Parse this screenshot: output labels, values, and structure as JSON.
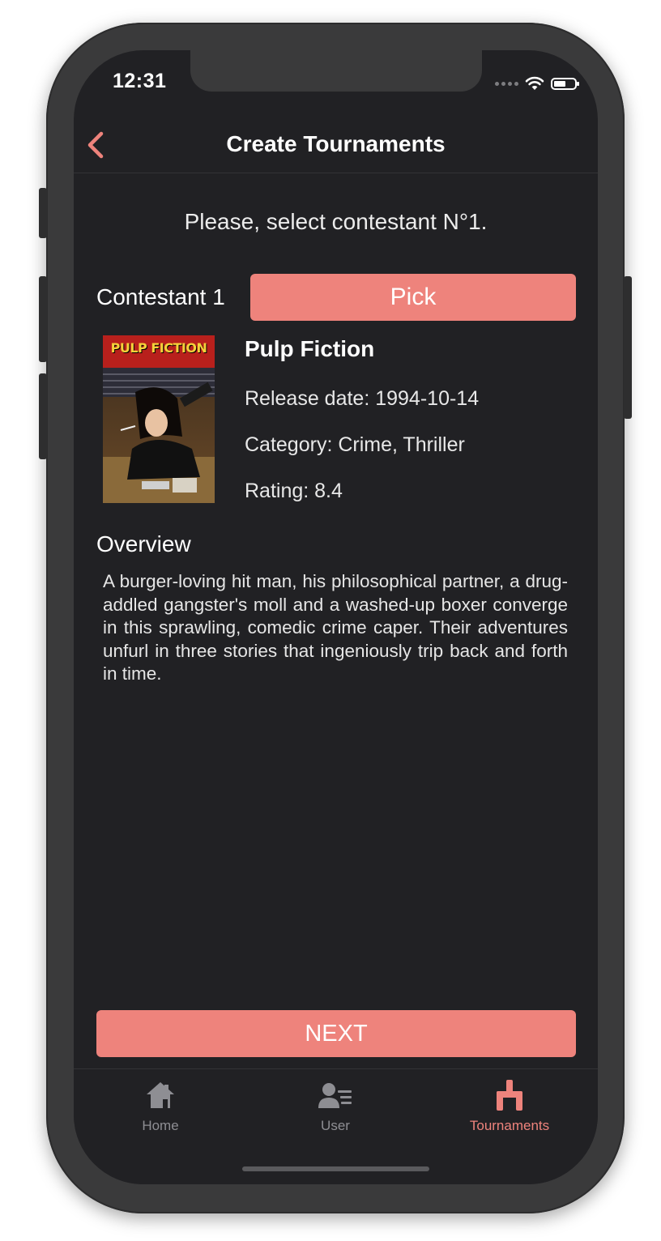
{
  "status_bar": {
    "time": "12:31"
  },
  "navbar": {
    "title": "Create Tournaments",
    "back_icon": "chevron-left-icon"
  },
  "prompt": "Please, select contestant N°1.",
  "contestant": {
    "label": "Contestant 1",
    "pick_label": "Pick"
  },
  "movie": {
    "title": "Pulp Fiction",
    "poster_title": "PULP FICTION",
    "release_date": "Release date: 1994-10-14",
    "category": "Category: Crime, Thriller",
    "rating": "Rating: 8.4"
  },
  "overview": {
    "label": "Overview",
    "text": "A burger-loving hit man, his philosophical partner, a drug-addled gangster's moll and a washed-up boxer converge in this sprawling, comedic crime caper. Their adventures unfurl in three stories that ingeniously trip back and forth in time."
  },
  "next_label": "NEXT",
  "tabs": [
    {
      "label": "Home",
      "icon": "home-icon",
      "active": false
    },
    {
      "label": "User",
      "icon": "user-list-icon",
      "active": false
    },
    {
      "label": "Tournaments",
      "icon": "tournament-icon",
      "active": true
    }
  ],
  "colors": {
    "accent": "#ee837c",
    "background": "#212124",
    "inactive_tab": "#8e8e93"
  }
}
